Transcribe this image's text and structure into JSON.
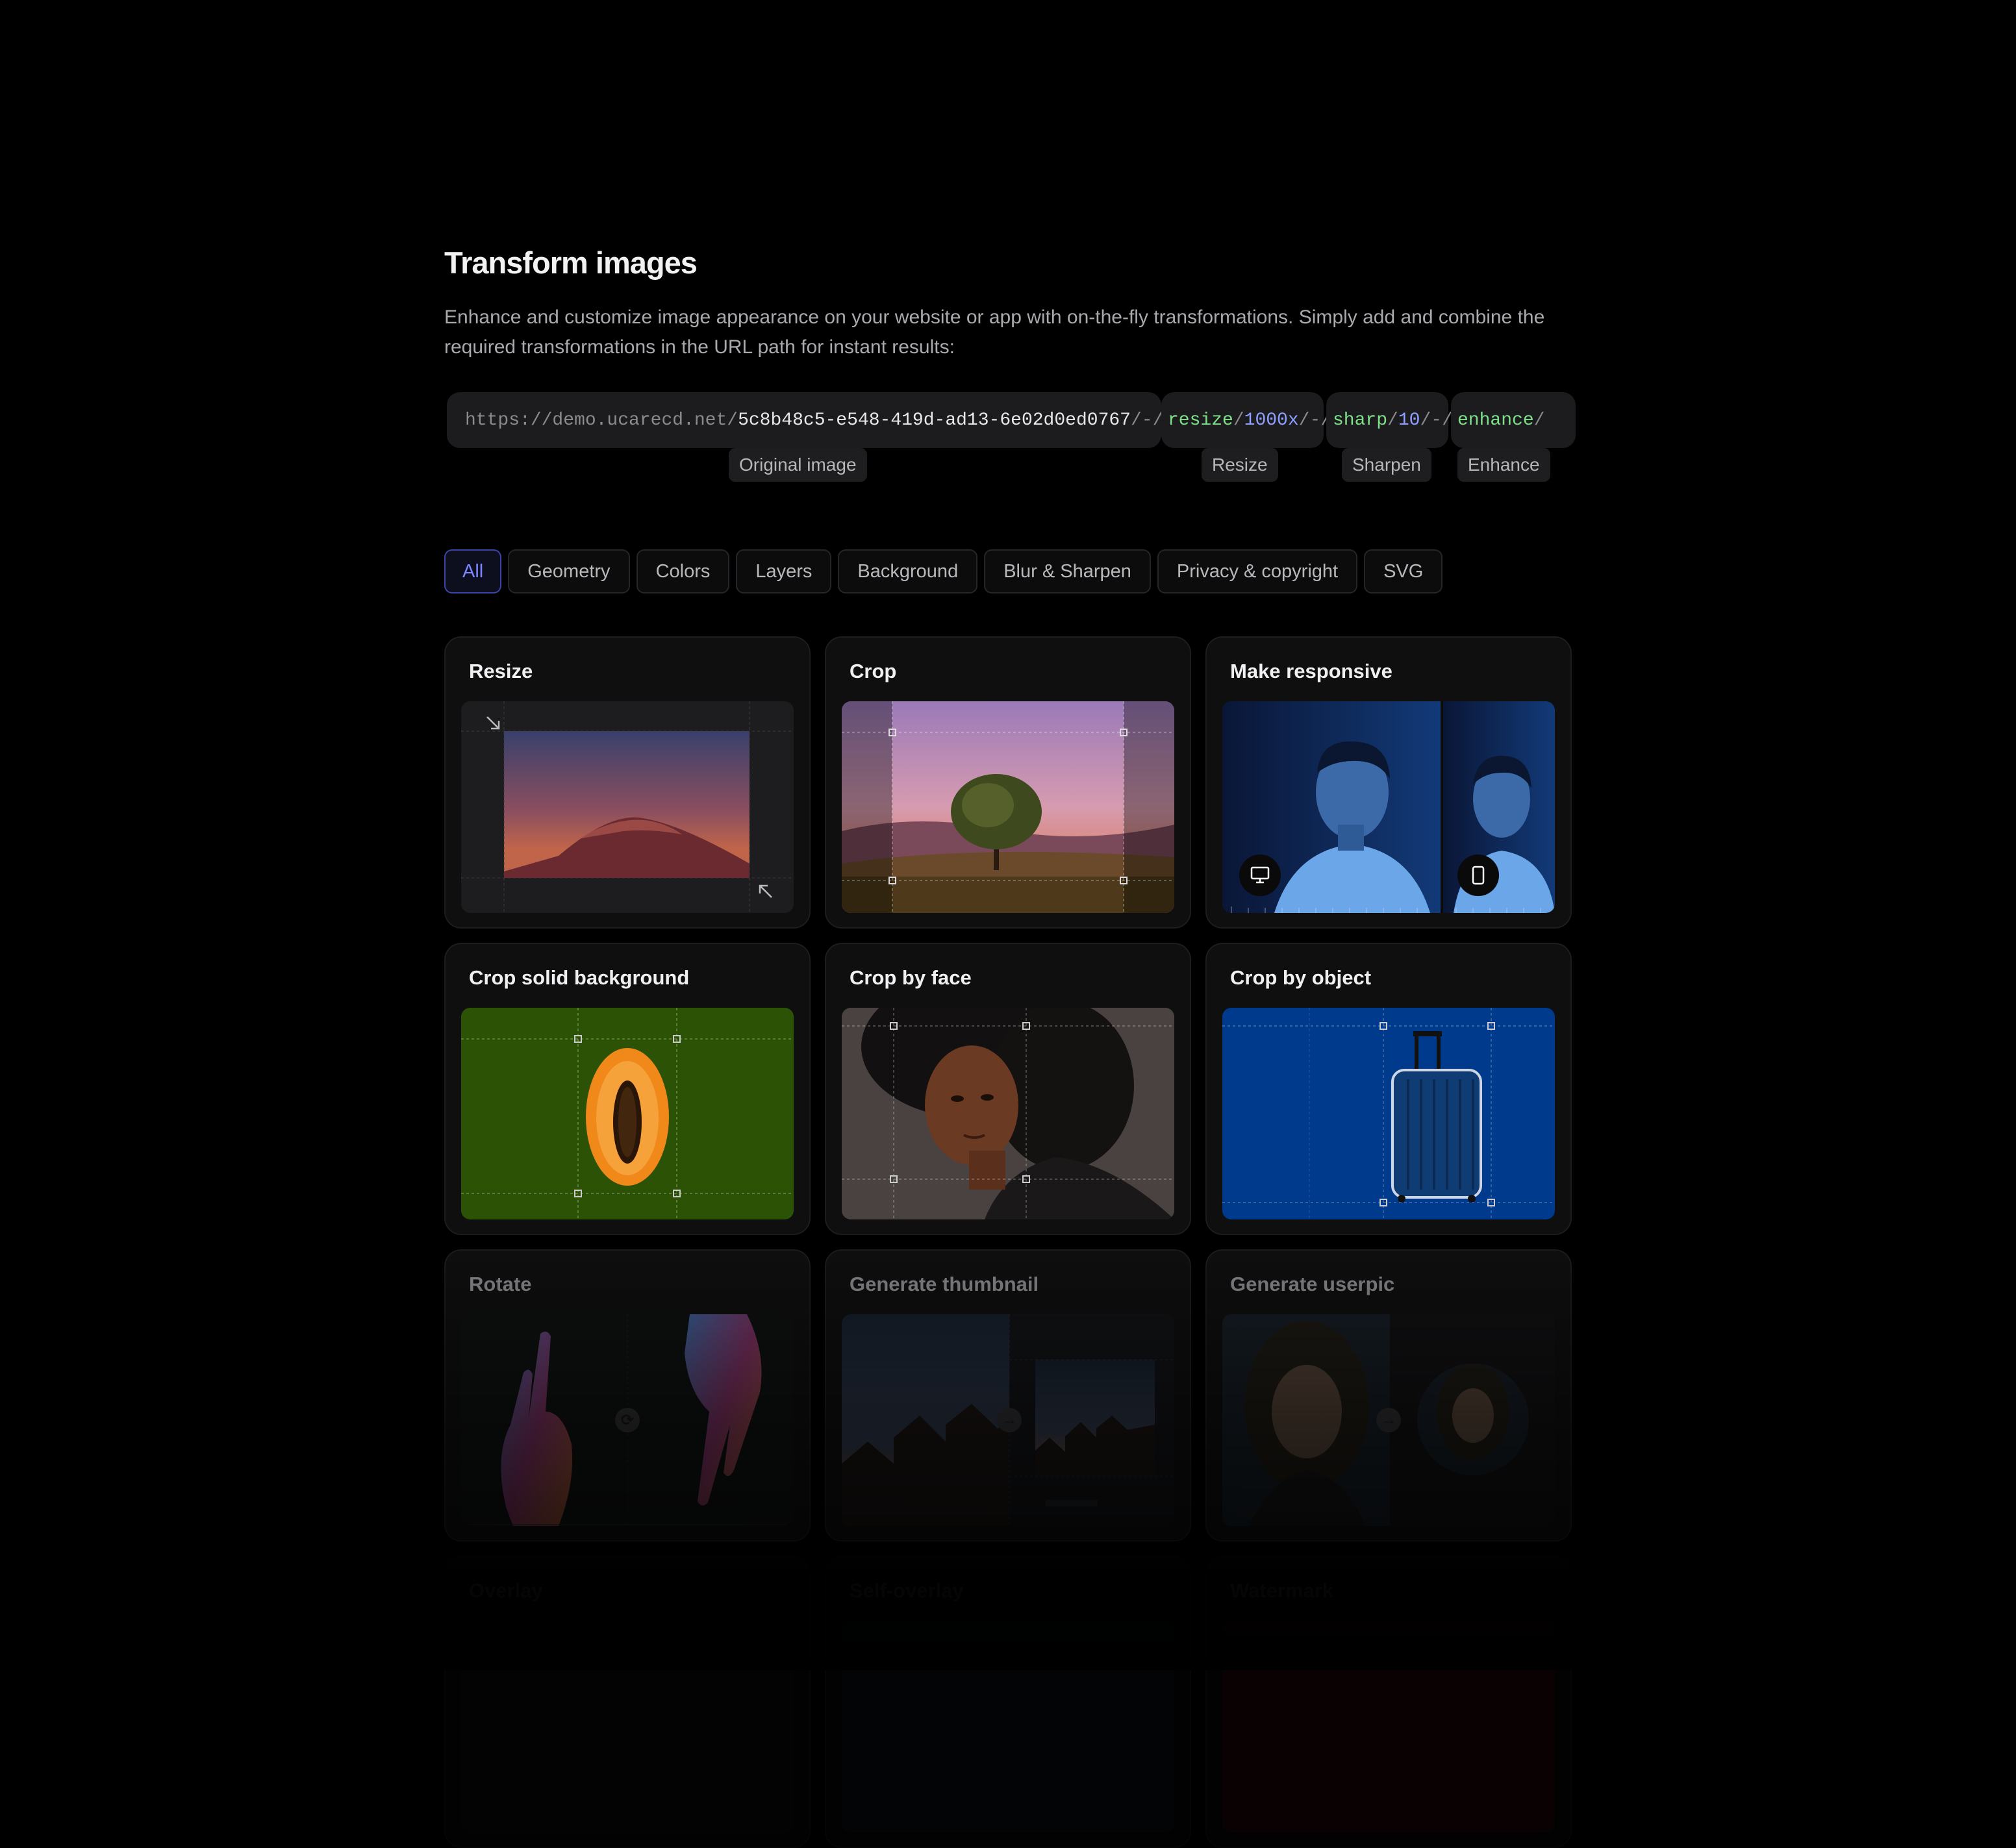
{
  "section": {
    "title": "Transform images",
    "description": "Enhance and customize image appearance on your website or app with on-the-fly transformations. Simply add and combine the required transformations in the URL path for instant results:"
  },
  "url": {
    "base": "https://demo.ucarecd.net/",
    "uuid": "5c8b48c5-e548-419d-ad13-6e02d0ed0767",
    "resize_prefix": "/-/",
    "resize_op": "resize",
    "resize_sep": "/",
    "resize_value": "1000x",
    "sharp_prefix": "/-/",
    "sharp_op": "sharp",
    "sharp_sep": "/",
    "sharp_value": "10",
    "enhance_prefix": "/-/",
    "enhance_op": "enhance",
    "enhance_end": "/"
  },
  "url_tags": [
    "Original image",
    "Resize",
    "Sharpen",
    "Enhance"
  ],
  "filters": [
    {
      "label": "All",
      "active": true
    },
    {
      "label": "Geometry"
    },
    {
      "label": "Colors"
    },
    {
      "label": "Layers"
    },
    {
      "label": "Background"
    },
    {
      "label": "Blur & Sharpen"
    },
    {
      "label": "Privacy & copyright"
    },
    {
      "label": "SVG"
    }
  ],
  "cards": [
    {
      "title": "Resize"
    },
    {
      "title": "Crop"
    },
    {
      "title": "Make responsive"
    },
    {
      "title": "Crop solid background"
    },
    {
      "title": "Crop by face"
    },
    {
      "title": "Crop by object"
    },
    {
      "title": "Rotate"
    },
    {
      "title": "Generate thumbnail"
    },
    {
      "title": "Generate userpic"
    },
    {
      "title": "Overlay"
    },
    {
      "title": "Self-overlay"
    },
    {
      "title": "Watermark"
    }
  ],
  "icons": {
    "desktop": "desktop-icon",
    "mobile": "mobile-icon",
    "rotate": "rotate-icon",
    "arrow": "arrow-right-icon"
  }
}
